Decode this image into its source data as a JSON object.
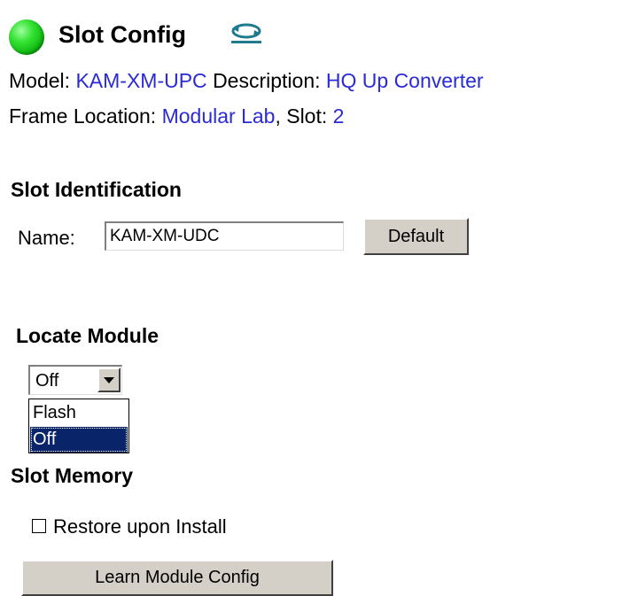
{
  "header": {
    "title": "Slot Config",
    "status_color": "#22cc22",
    "refresh_icon": "refresh-icon"
  },
  "info": {
    "model_label": "Model:",
    "model_value": "KAM-XM-UPC",
    "description_label": "Description:",
    "description_value": "HQ Up Converter",
    "frame_location_label": "Frame Location:",
    "frame_location_value": "Modular Lab",
    "slot_label": ", Slot:",
    "slot_value": "2"
  },
  "slot_identification": {
    "heading": "Slot Identification",
    "name_label": "Name:",
    "name_value": "KAM-XM-UDC",
    "default_button": "Default"
  },
  "locate_module": {
    "heading": "Locate Module",
    "selected": "Off",
    "options": [
      "Flash",
      "Off"
    ]
  },
  "slot_memory": {
    "heading": "Slot Memory",
    "restore_label": "Restore upon Install",
    "restore_checked": false,
    "learn_button": "Learn Module Config"
  },
  "colors": {
    "link": "#2a2ad6",
    "selected_option_bg": "#0a246a",
    "button_face": "#d4d0c8"
  }
}
